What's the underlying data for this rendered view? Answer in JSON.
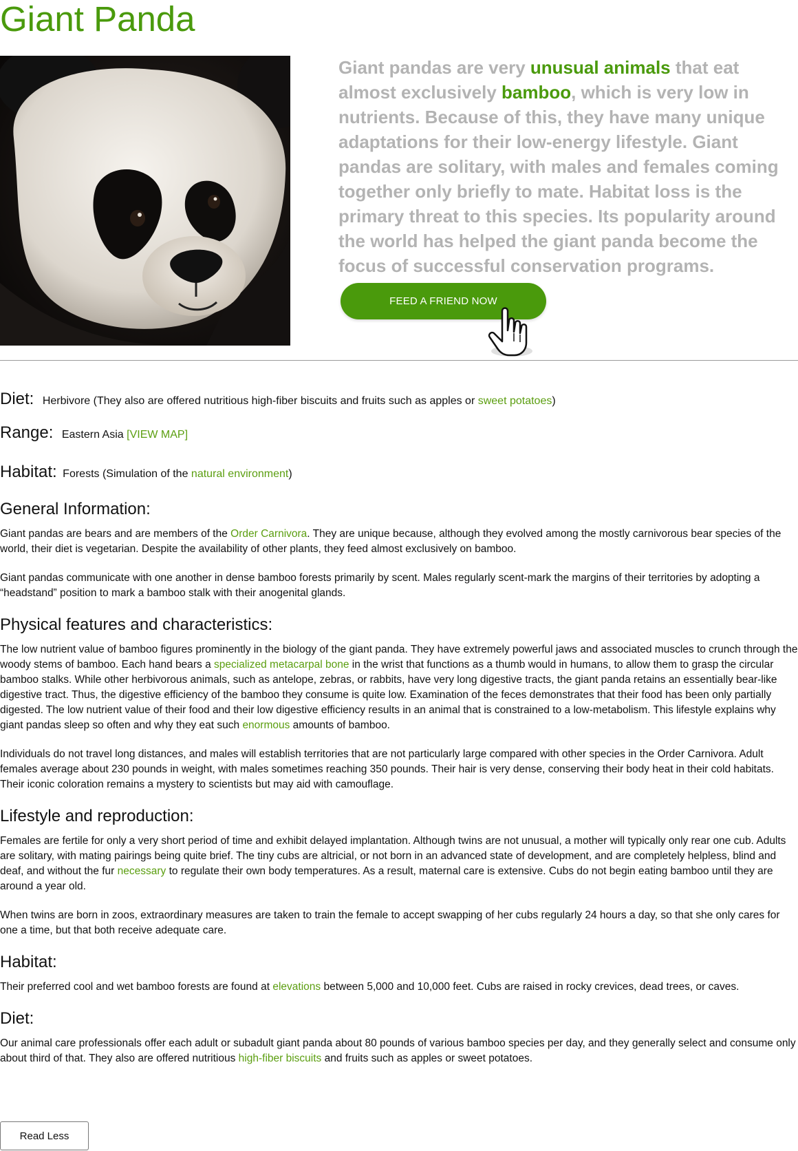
{
  "page": {
    "title": "Giant Panda"
  },
  "hero": {
    "intro": [
      {
        "text": "Giant pandas are very "
      },
      {
        "text": "unusual animals",
        "link": true
      },
      {
        "text": " that eat almost exclusively "
      },
      {
        "text": "bamboo",
        "link": true
      },
      {
        "text": ", which is very low in nutrients. Because of this, they have many unique adaptations for their low-energy lifestyle. Giant pandas are solitary, with males and females coming together only briefly to mate. Habitat loss is the primary threat to this species. Its popularity around the world has helped the giant panda become the focus of successful conservation programs."
      }
    ],
    "cta_label": "FEED A FRIEND NOW"
  },
  "facts": {
    "diet": {
      "label": "Diet:",
      "value": [
        {
          "text": "Herbivore (They also are offered nutritious high-fiber biscuits and fruits such as apples or "
        },
        {
          "text": "sweet potatoes",
          "link": true
        },
        {
          "text": ")"
        }
      ]
    },
    "range": {
      "label": "Range:",
      "value": [
        {
          "text": "Eastern Asia "
        },
        {
          "text": "[VIEW MAP]",
          "link": true
        }
      ]
    },
    "habitat": {
      "label": "Habitat:",
      "value": [
        {
          "text": "Forests (Simulation of the "
        },
        {
          "text": "natural environment",
          "link": true
        },
        {
          "text": ")"
        }
      ]
    }
  },
  "sections": [
    {
      "heading": "General Information:",
      "paragraphs": [
        [
          {
            "text": "Giant pandas are bears and are members of the "
          },
          {
            "text": "Order Carnivora",
            "link": true
          },
          {
            "text": ". They are unique because, although they evolved among the mostly carnivorous bear species of the world, their diet is vegetarian. Despite the availability of other plants, they feed almost exclusively on bamboo."
          }
        ],
        [
          {
            "text": "Giant pandas communicate with one another in dense bamboo forests primarily by scent. Males regularly scent-mark the margins of their territories by adopting a “headstand” position to mark a bamboo stalk with their anogenital glands."
          }
        ]
      ]
    },
    {
      "heading": "Physical features and characteristics:",
      "paragraphs": [
        [
          {
            "text": "The low nutrient value of bamboo figures prominently in the biology of the giant panda. They have extremely powerful jaws and associated muscles to crunch through the woody stems of bamboo. Each hand bears a "
          },
          {
            "text": "specialized metacarpal bone",
            "link": true
          },
          {
            "text": " in the wrist that functions as a thumb would in humans, to allow them to grasp the circular bamboo stalks. While other herbivorous animals, such as antelope, zebras, or rabbits, have very long digestive tracts, the giant panda retains an essentially bear-like digestive tract. Thus, the digestive efficiency of the bamboo they consume is quite low. Examination of the feces demonstrates that their food has been only partially digested. The low nutrient value of their food and their low digestive efficiency results in an animal that is constrained to a low-metabolism. This lifestyle explains why giant pandas sleep so often and why they eat such "
          },
          {
            "text": "enormous",
            "link": true
          },
          {
            "text": " amounts of bamboo."
          }
        ],
        [
          {
            "text": "Individuals do not travel long distances, and males will establish territories that are not particularly large compared with other species in the Order Carnivora. Adult females average about 230 pounds in weight, with males sometimes reaching 350 pounds. Their hair is very dense, conserving their body heat in their cold habitats. Their iconic coloration remains a mystery to scientists but may aid with camouflage."
          }
        ]
      ]
    },
    {
      "heading": "Lifestyle and reproduction:",
      "paragraphs": [
        [
          {
            "text": "Females are fertile for only a very short period of time and exhibit delayed implantation. Although twins are not unusual, a mother will typically only rear one cub. Adults are solitary, with mating pairings being quite brief. The tiny cubs are altricial, or not born in an advanced state of development, and are completely helpless, blind and deaf, and without the fur "
          },
          {
            "text": "necessary",
            "link": true
          },
          {
            "text": " to regulate their own body temperatures. As a result, maternal care is extensive. Cubs do not begin eating bamboo until they are around a year old."
          }
        ],
        [
          {
            "text": "When twins are born in zoos, extraordinary measures are taken to train the female to accept swapping of her cubs regularly 24 hours a day, so that she only cares for one a time, but that both receive adequate care."
          }
        ]
      ]
    },
    {
      "heading": "Habitat:",
      "paragraphs": [
        [
          {
            "text": "Their preferred cool and wet bamboo forests are found at "
          },
          {
            "text": "elevations",
            "link": true
          },
          {
            "text": " between 5,000 and 10,000 feet. Cubs are raised in rocky crevices, dead trees, or caves."
          }
        ]
      ]
    },
    {
      "heading": "Diet:",
      "paragraphs": [
        [
          {
            "text": "Our animal care professionals offer each adult or subadult giant panda about 80 pounds of various bamboo species per day, and they generally select and consume only about third of that. They also are offered nutritious "
          },
          {
            "text": "high-fiber biscuits",
            "link": true
          },
          {
            "text": " and fruits such as apples or sweet potatoes."
          }
        ]
      ]
    }
  ],
  "footer": {
    "read_less_label": "Read Less"
  },
  "colors": {
    "accent": "#4a9a0c",
    "link": "#5b9e10",
    "intro_text": "#b3b3b3"
  },
  "icons": {
    "cursor": "pointer-hand-icon"
  }
}
